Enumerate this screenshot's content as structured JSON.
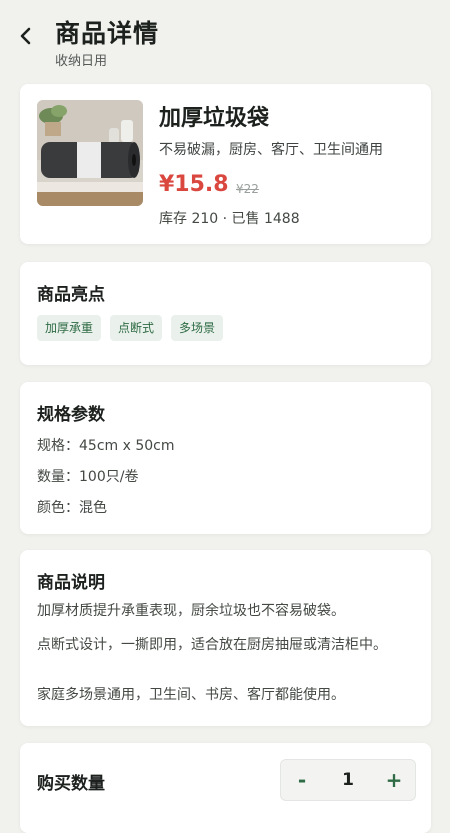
{
  "header": {
    "title": "商品详情",
    "subtitle": "收纳日用"
  },
  "product": {
    "name": "加厚垃圾袋",
    "tagline": "不易破漏，厨房、客厅、卫生间通用",
    "price": "¥15.8",
    "original_price": "¥22",
    "stock_sales": "库存 210 · 已售 1488"
  },
  "highlights": {
    "title": "商品亮点",
    "tags": [
      "加厚承重",
      "点断式",
      "多场景"
    ]
  },
  "specs": {
    "title": "规格参数",
    "rows": [
      "规格：45cm x 50cm",
      "数量：100只/卷",
      "颜色：混色"
    ]
  },
  "description": {
    "title": "商品说明",
    "lines": [
      "加厚材质提升承重表现，厨余垃圾也不容易破袋。",
      "点断式设计，一撕即用，适合放在厨房抽屉或清洁柜中。",
      "家庭多场景通用，卫生间、书房、客厅都能使用。"
    ]
  },
  "quantity": {
    "title": "购买数量",
    "minus": "-",
    "value": "1",
    "plus": "+"
  },
  "colors": {
    "background": "#f1f2ee",
    "price": "#d9473f",
    "accent_green": "#2f6b44",
    "tag_bg": "#eaf1ec"
  }
}
